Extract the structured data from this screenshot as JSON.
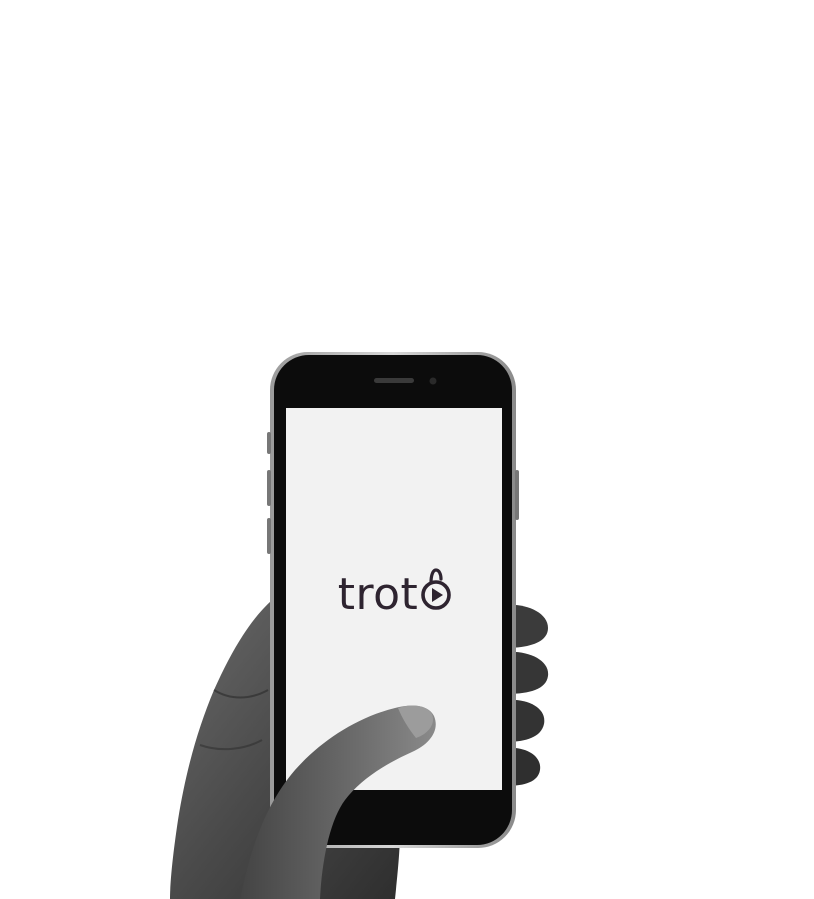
{
  "screen": {
    "brand_text": "troto",
    "brand_text_part": "trot",
    "brand_color": "#2e2430",
    "screen_color": "#f2f2f2",
    "phone_color": "#0c0c0c"
  },
  "icons": {
    "brand_mark": "play-in-padlock-icon",
    "earpiece": "speaker-grille-icon",
    "camera": "front-camera-icon"
  }
}
